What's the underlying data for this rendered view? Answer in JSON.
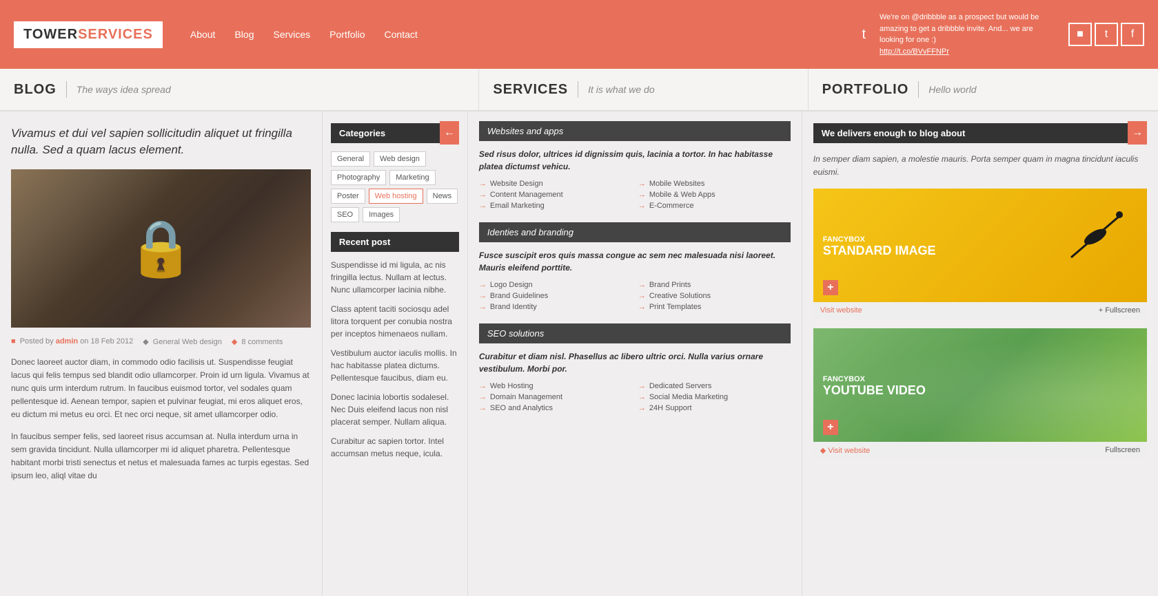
{
  "header": {
    "logo_tower": "TOWER",
    "logo_services": "SERVICES",
    "nav": [
      "About",
      "Blog",
      "Services",
      "Portfolio",
      "Contact"
    ],
    "tweet_text": "We're on @dribbble as a prospect but would be amazing to get a dribbble invite. And... we are looking for one :)",
    "tweet_link": "http://t.co/BVvFFNPr",
    "social_icons": [
      "&#9632;",
      "&#116;",
      "&#102;"
    ]
  },
  "sections": {
    "blog": {
      "title": "BLOG",
      "subtitle": "The ways idea spread"
    },
    "services": {
      "title": "SERVICES",
      "subtitle": "It is what we do"
    },
    "portfolio": {
      "title": "PORTFOLIO",
      "subtitle": "Hello world"
    }
  },
  "blog": {
    "post_title": "Vivamus et dui vel sapien sollicitudin aliquet ut fringilla nulla. Sed a quam lacus element.",
    "meta_posted": "Posted by",
    "meta_author": "admin",
    "meta_date": "on 18 Feb 2012",
    "meta_category": "General Web design",
    "meta_comments": "8 comments",
    "body1": "Donec laoreet auctor diam, in commodo odio facilisis ut. Suspendisse feugiat lacus qui felis tempus sed blandit odio ullamcorper. Proin id urn ligula. Vivamus at nunc quis urm interdum rutrum. In faucibus euismod tortor, vel sodales quam pellentesque id. Aenean tempor, sapien et pulvinar feugiat, mi eros aliquet eros, eu dictum mi metus eu orci. Et nec orci neque, sit amet ullamcorper odio.",
    "body2": "In faucibus semper felis, sed laoreet risus accumsan at. Nulla interdum urna in sem gravida tincidunt. Nulla ullamcorper mi id aliquet pharetra. Pellentesque habitant morbi tristi senectus et netus et malesuada fames ac turpis egestas. Sed ipsum leo, aliql vitae du"
  },
  "sidebar": {
    "categories_label": "Categories",
    "tags": [
      "General",
      "Web design",
      "Photography",
      "Marketing",
      "Poster",
      "Web hosting",
      "News",
      "SEO",
      "Images"
    ],
    "active_tag": "Web hosting",
    "recent_post_label": "Recent post",
    "recent1": "Suspendisse id mi ligula, ac nis fringilla lectus. Nullam at lectus. Nunc ullamcorper lacinia nibhe.",
    "recent2": "Class aptent taciti sociosqu adel litora torquent per conubia nostra per inceptos himenaeos nullam.",
    "recent3": "Vestibulum auctor iaculis mollis. In hac habitasse platea dictums. Pellentesque faucibus, diam eu.",
    "recent4": "Donec lacinia lobortis sodalesel. Nec Duis eleifend lacus non nisl placerat semper. Nullam aliqua.",
    "recent5": "Curabitur ac sapien tortor. Intel accumsan metus neque, icula."
  },
  "services": {
    "section1": {
      "header": "Websites and apps",
      "desc": "Sed risus dolor, ultrices id dignissim quis, lacinia a tortor. In hac habitasse platea dictumst vehicu.",
      "items_left": [
        "Website Design",
        "Content Management",
        "Email Marketing"
      ],
      "items_right": [
        "Mobile Websites",
        "Mobile & Web Apps",
        "E-Commerce"
      ]
    },
    "section2": {
      "header": "Identies and branding",
      "desc": "Fusce suscipit eros quis massa congue ac sem nec malesuada nisi laoreet. Mauris eleifend porttite.",
      "items_left": [
        "Logo Design",
        "Brand Guidelines",
        "Brand Identity"
      ],
      "items_right": [
        "Brand Prints",
        "Creative Solutions",
        "Print Templates"
      ]
    },
    "section3": {
      "header": "SEO solutions",
      "desc": "Curabitur et diam nisl. Phasellus ac libero ultric orci. Nulla varius ornare vestibulum. Morbi por.",
      "items_left": [
        "Web Hosting",
        "Domain Management",
        "SEO and Analytics"
      ],
      "items_right": [
        "Dedicated Servers",
        "Social Media Marketing",
        "24H Support"
      ]
    }
  },
  "portfolio": {
    "section_label": "We delivers enough to blog about",
    "intro": "In semper diam sapien, a molestie mauris. Porta semper quam in magna tincidunt iaculis euismi.",
    "item1": {
      "label": "FANCYBOX",
      "sublabel": "STANDARD IMAGE",
      "visit": "Visit website",
      "fullscreen": "+ Fullscreen"
    },
    "item2": {
      "label": "FANCYBOX",
      "sublabel": "YOUTUBE VIDEO",
      "visit": "Visit website",
      "fullscreen": "Fullscreen"
    }
  }
}
